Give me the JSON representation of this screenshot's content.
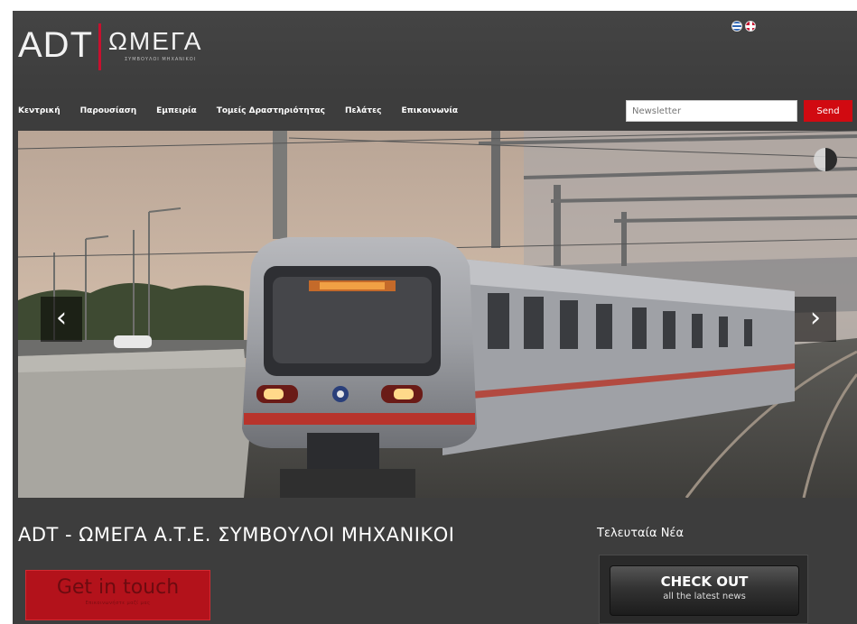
{
  "header": {
    "logo_main": "ADT",
    "logo_omega": "ΩΜΕΓΑ",
    "logo_sub": "ΣΥΜΒΟΥΛΟΙ ΜΗΧΑΝΙΚΟΙ"
  },
  "nav": {
    "items": [
      {
        "label": "Κεντρική"
      },
      {
        "label": "Παρουσίαση"
      },
      {
        "label": "Εμπειρία"
      },
      {
        "label": "Τομείς Δραστηριότητας"
      },
      {
        "label": "Πελάτες"
      },
      {
        "label": "Επικοινωνία"
      }
    ]
  },
  "newsletter": {
    "placeholder": "Newsletter",
    "button_label": "Send"
  },
  "slider": {
    "prev_arrow": "‹",
    "next_arrow": "›"
  },
  "main": {
    "title": "ADT - ΩΜΕΓΑ Α.Τ.Ε. ΣΥΜΒΟΥΛΟΙ ΜΗΧΑΝΙΚΟΙ",
    "cta_label": "Get in touch",
    "cta_sub": "Επικοινωνήστε μαζί μας"
  },
  "news": {
    "heading": "Τελευταία Νέα",
    "button_main": "CHECK OUT",
    "button_sub": "all the latest news"
  },
  "colors": {
    "accent_red": "#d10a11",
    "page_bg": "#3d3d3d"
  },
  "icons": {
    "language_greek": "greek-flag-icon",
    "language_english": "uk-flag-icon",
    "slider_pause": "pie-timer-icon"
  }
}
